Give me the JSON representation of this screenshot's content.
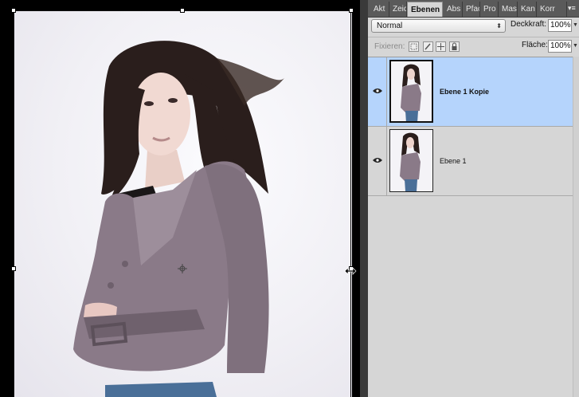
{
  "panel": {
    "tabs": [
      {
        "label": "Akt",
        "active": false
      },
      {
        "label": "Zeic",
        "active": false
      },
      {
        "label": "Ebenen",
        "active": true
      },
      {
        "label": "Abs",
        "active": false
      },
      {
        "label": "Pfac",
        "active": false
      },
      {
        "label": "Pro",
        "active": false
      },
      {
        "label": "Mas",
        "active": false
      },
      {
        "label": "Kan",
        "active": false
      },
      {
        "label": "Korr",
        "active": false
      }
    ],
    "menu_icon": "panel-menu-icon",
    "blend_mode": "Normal",
    "opacity_label": "Deckkraft:",
    "opacity_value": "100%",
    "lock_label": "Fixieren:",
    "fill_label": "Fläche:",
    "fill_value": "100%",
    "lock_icons": [
      "lock-transparency-icon",
      "lock-pixels-icon",
      "lock-position-icon",
      "lock-all-icon"
    ]
  },
  "layers": [
    {
      "name": "Ebene 1 Kopie",
      "visible": true,
      "selected": true
    },
    {
      "name": "Ebene 1",
      "visible": true,
      "selected": false
    }
  ],
  "colors": {
    "selection": "#b5d4fc",
    "panel_bg": "#d6d6d6",
    "tabbar_bg": "#5a5a5a",
    "jacket": "#8a7a88",
    "hair": "#2a1e1c"
  }
}
